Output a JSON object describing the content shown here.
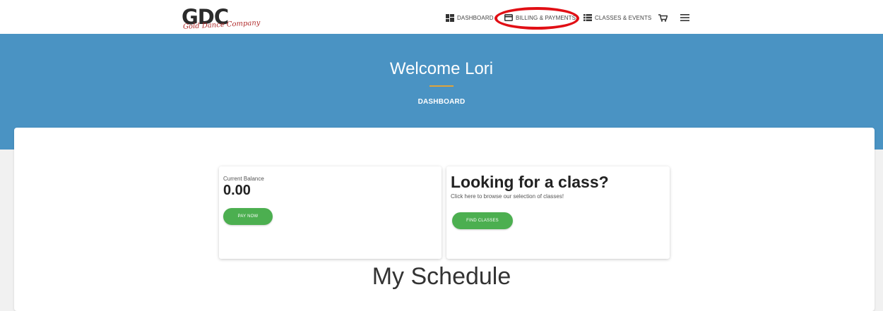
{
  "brand": {
    "logo_text": "GDC",
    "logo_script": "Gold Dance Company"
  },
  "nav": {
    "dashboard": "DASHBOARD",
    "billing": "BILLING & PAYMENTS",
    "classes": "CLASSES & EVENTS"
  },
  "hero": {
    "title": "Welcome Lori",
    "subtitle": "DASHBOARD"
  },
  "balance_card": {
    "label": "Current Balance",
    "value": "0.00",
    "button": "PAY NOW"
  },
  "class_card": {
    "title": "Looking for a class?",
    "subtitle": "Click here to browse our selection of classes!",
    "button": "FIND CLASSES"
  },
  "schedule": {
    "title": "My Schedule"
  },
  "colors": {
    "hero_bg": "#4a93c3",
    "accent_underline": "#e0a43a",
    "button_green": "#4caf50",
    "highlight_ring": "#e10f15"
  }
}
